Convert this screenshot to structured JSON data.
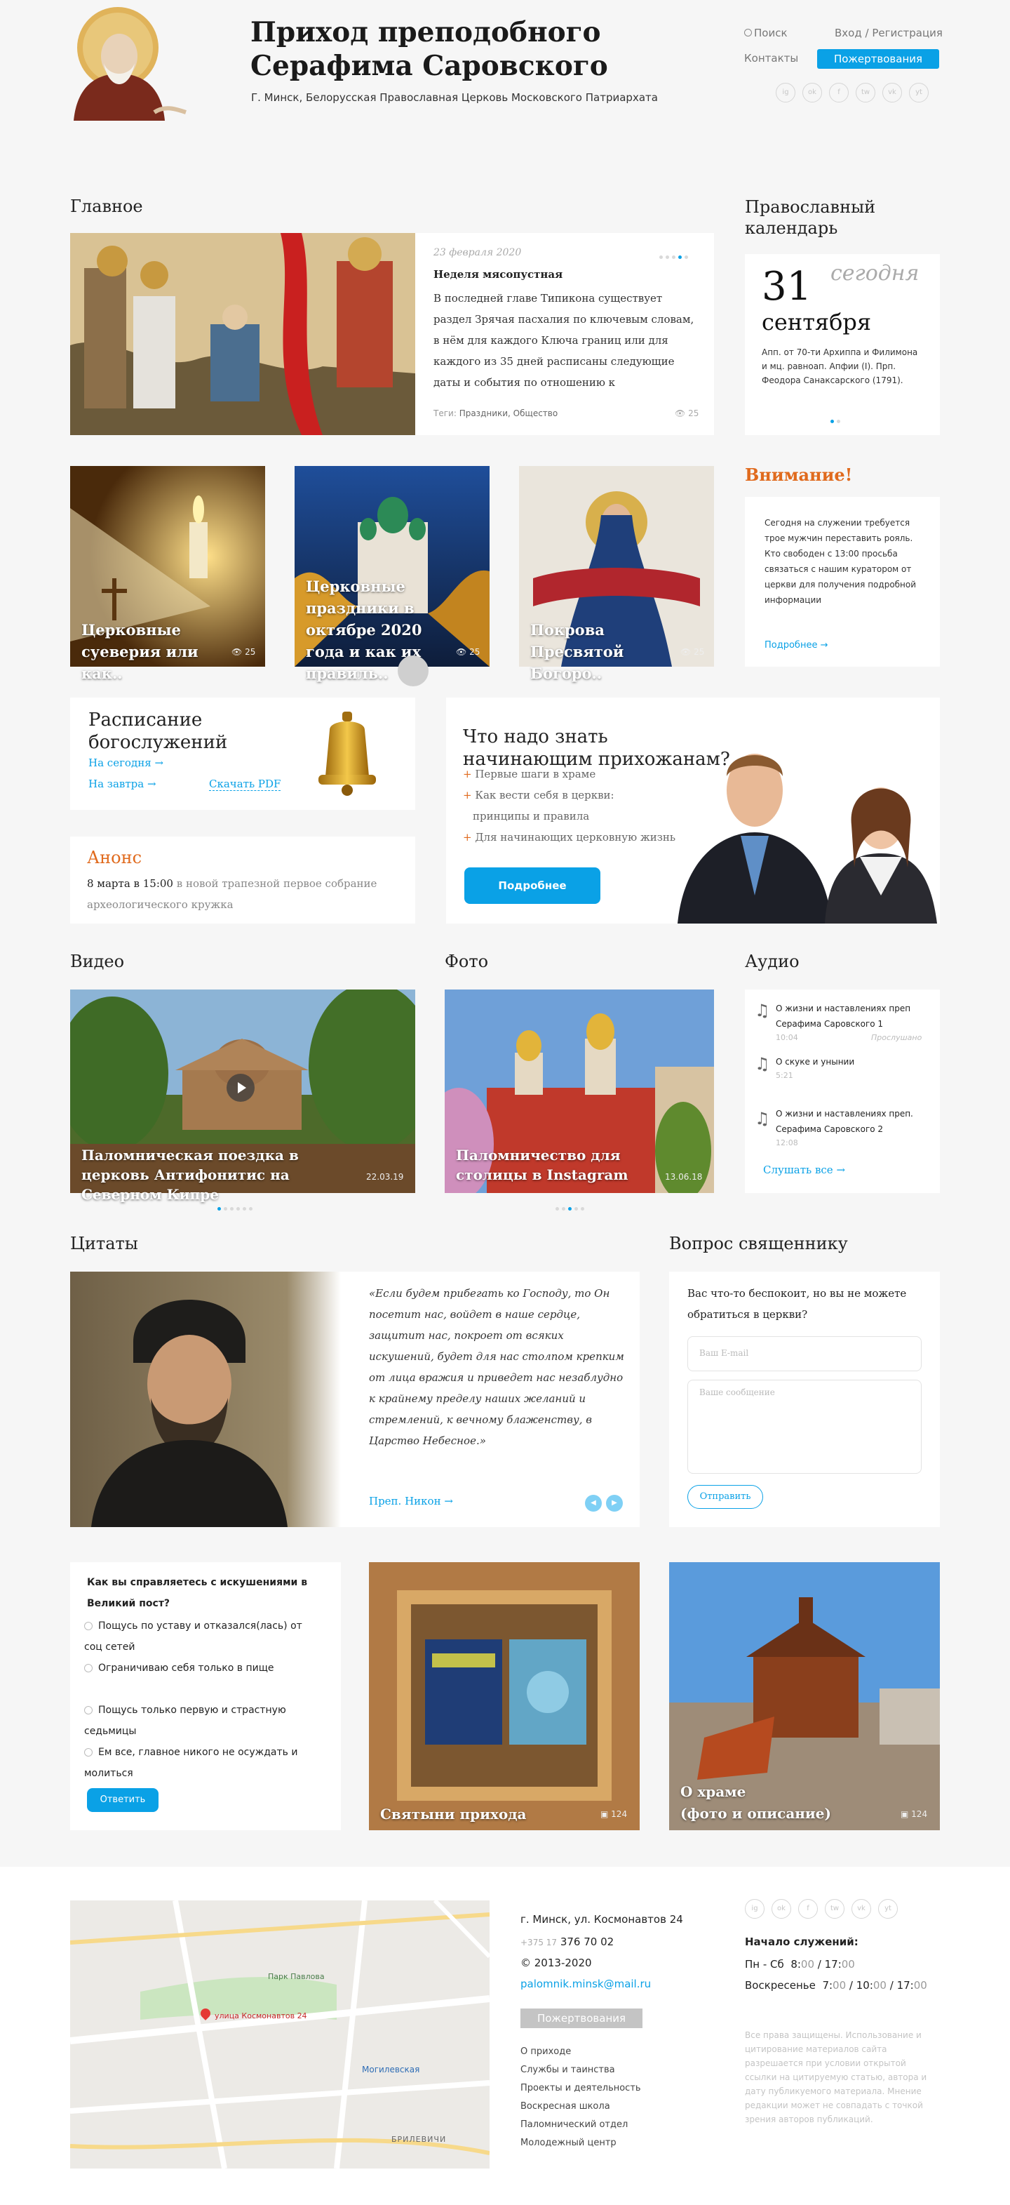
{
  "header": {
    "title_line1": "Приход преподобного",
    "title_line2": "Серафима Саровского",
    "subtitle": "Г. Минск, Белорусская Православная Церковь Московского Патриархата",
    "search": "Поиск",
    "login": "Вход",
    "sep": "/",
    "register": "Регистрация",
    "contacts": "Контакты",
    "donate": "Пожертвования",
    "social": [
      "ig",
      "ok",
      "f",
      "tw",
      "vk",
      "yt"
    ]
  },
  "main": {
    "title": "Главное",
    "date": "23 февраля 2020",
    "headline": "Неделя мясопустная",
    "text": "В последней главе Типикона существует раздел Зрячая пасхалия по ключевым словам, в нём для каждого Ключа границ или для каждого из 35 дней расписаны следующие даты и события по отношению к",
    "tags_label": "Теги:",
    "tags": "Праздники, Общество",
    "views": "25"
  },
  "calendar": {
    "title": "Православный календарь",
    "day": "31",
    "today": "сегодня",
    "month": "сентября",
    "text": "Апп. от 70-ти Архиппа и Филимона и мц. равноап. Апфии (I). Прп. Феодора Санаксарского (1791)."
  },
  "tiles": [
    {
      "title": "Церковные суеверия или как..",
      "views": "25"
    },
    {
      "title": "Церковные праздники в октябре 2020 года и как их правиль..",
      "views": "25"
    },
    {
      "title": "Покрова Пресвятой Богоро..",
      "views": "25"
    }
  ],
  "attention": {
    "title": "Внимание!",
    "text": "Сегодня на служении требуется трое мужчин переставить рояль. Кто свободен с 13:00 просьба связаться с нашим куратором от церкви для получения подробной информации",
    "more": "Подробнее"
  },
  "schedule": {
    "title": "Расписание богослужений",
    "today": "На сегодня",
    "tomorrow": "На завтра",
    "pdf": "Скачать PDF"
  },
  "anons": {
    "title": "Анонс",
    "date": "8 марта в 15:00",
    "text": "в новой трапезной первое собрание археологического кружка"
  },
  "newcomers": {
    "title": "Что надо знать начинающим прихожанам?",
    "items": [
      "Первые шаги в храме",
      "Как вести себя в церкви:",
      "принципы и правила",
      "Для начинающих церковную жизнь"
    ],
    "button": "Подробнее"
  },
  "video": {
    "title": "Видео",
    "caption": "Паломническая поездка в церковь Антифонитис на Северном Кипре",
    "date": "22.03.19"
  },
  "photo": {
    "title": "Фото",
    "caption": "Паломничество для столицы в Instagram",
    "date": "13.06.18"
  },
  "audio": {
    "title": "Аудио",
    "items": [
      {
        "title": "О жизни и наставлениях преп Серафима Саровского 1",
        "time": "10:04",
        "status": "Прослушано"
      },
      {
        "title": "О скуке и унынии",
        "time": "5:21",
        "status": ""
      },
      {
        "title": "О жизни и наставлениях преп. Серафима Саровского 2",
        "time": "12:08",
        "status": ""
      }
    ],
    "listen_all": "Слушать все"
  },
  "quotes": {
    "title": "Цитаты",
    "text": "«Если будем прибегать ко Господу, то Он посетит нас, войдет в наше сердце, защитит нас, покроет от всяких искушений, будет для нас столпом крепким от лица вражия и приведет нас незаблудно к крайнему пределу наших желаний и стремлений, к вечному блаженству, в Царство Небесное.»",
    "author": "Преп. Никон"
  },
  "question": {
    "title": "Вопрос священнику",
    "text": "Вас что-то беспокоит, но вы не можете обратиться в церкви?",
    "email_placeholder": "Ваш E-mail",
    "message_placeholder": "Ваше сообщение",
    "send": "Отправить"
  },
  "poll": {
    "question": "Как вы справляетесь с искушениями в Великий пост?",
    "options": [
      "Пощусь по уставу и отказался(лась) от соц сетей",
      "Ограничиваю себя только в пище",
      "Пощусь только первую и страстную седьмицы",
      "Ем все, главное никого не осуждать и молиться"
    ],
    "answer": "Ответить"
  },
  "shrines": {
    "caption": "Святыни прихода",
    "count": "124"
  },
  "temple": {
    "caption_line1": "О храме",
    "caption_line2": "(фото и описание)",
    "count": "124"
  },
  "footer": {
    "map_labels": [
      "Парк Павлова",
      "улица Космонавтов 24",
      "Могилевская",
      "БРИЛЕВИЧИ"
    ],
    "address": "г. Минск, ул. Космонавтов 24",
    "phone_prefix": "+375 17",
    "phone": "376 70 02",
    "copyright": "©  2013-2020",
    "email": "palomnik.minsk@mail.ru",
    "donate": "Пожертвования",
    "links": [
      "О приходе",
      "Службы и таинства",
      "Проекты и деятельность",
      "Воскресная школа",
      "Паломнический отдел",
      "Молодежный центр"
    ],
    "services_title": "Начало служений:",
    "weekdays": "Пн - Сб",
    "weekdays_times": [
      "8",
      "00",
      "17",
      "00"
    ],
    "sunday": "Воскресенье",
    "sunday_times": [
      "7",
      "00",
      "10",
      "00",
      "17",
      "00"
    ],
    "rights": "Все права защищены. Использование и цитирование материалов сайта разрешается при условии открытой ссылки на цитируемую статью, автора и дату публикуемого материала. Мнение редакции может не совпадать с точкой зрения авторов публикаций."
  },
  "colors": {
    "accent": "#0aa1e6",
    "orange": "#e06a1d",
    "background": "#f6f6f6"
  }
}
